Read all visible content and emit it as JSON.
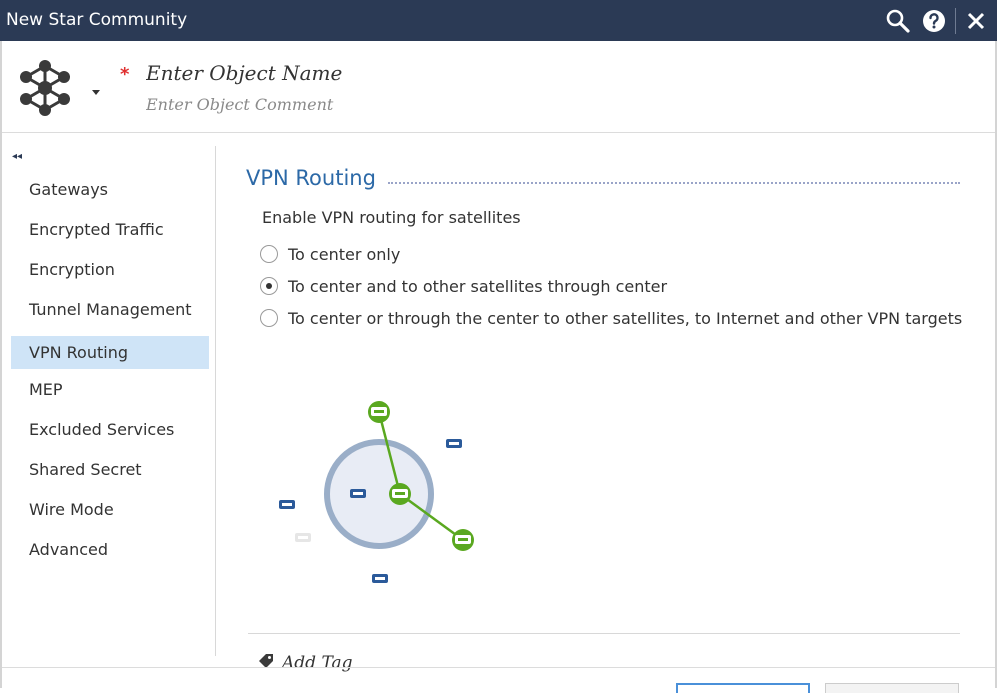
{
  "window": {
    "title": "New Star Community"
  },
  "header": {
    "required_mark": "*",
    "name_placeholder": "Enter Object Name",
    "comment_placeholder": "Enter Object Comment"
  },
  "sidebar": {
    "collapse_glyph": "◂◂",
    "items": [
      {
        "label": "Gateways"
      },
      {
        "label": "Encrypted Traffic"
      },
      {
        "label": "Encryption"
      },
      {
        "label": "Tunnel Management"
      },
      {
        "label": "VPN Routing",
        "selected": true
      },
      {
        "label": "MEP"
      },
      {
        "label": "Excluded Services"
      },
      {
        "label": "Shared Secret"
      },
      {
        "label": "Wire Mode"
      },
      {
        "label": "Advanced"
      }
    ]
  },
  "main": {
    "section_title": "VPN Routing",
    "enable_label": "Enable VPN routing for satellites",
    "options": [
      {
        "label": "To center only",
        "checked": false
      },
      {
        "label": "To center and to other satellites through center",
        "checked": true
      },
      {
        "label": "To center or through the center to other satellites, to Internet and other VPN targets",
        "checked": false
      }
    ],
    "add_tag_label": "Add Tag"
  },
  "colors": {
    "titlebar": "#2b3a55",
    "accent": "#2c69a7",
    "selected_nav": "#cfe4f7",
    "route_green": "#5aa820",
    "ring": "#9aaec8"
  },
  "icons": {
    "search": "search-icon",
    "help": "help-icon",
    "close": "close-icon",
    "object": "star-community-icon",
    "caret": "caret-down-icon",
    "tag": "tag-icon"
  }
}
